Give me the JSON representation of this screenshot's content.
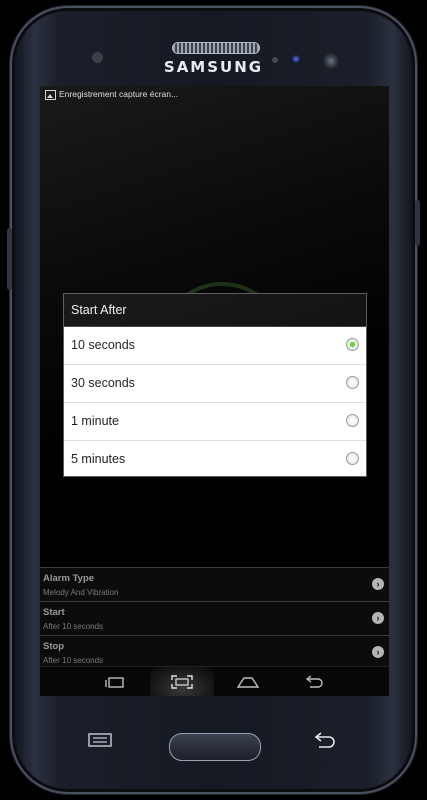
{
  "device": {
    "brand": "SAMSUNG"
  },
  "status_bar": {
    "notification_text": "Enregistrement capture écran...",
    "icon": "image-icon"
  },
  "dialog": {
    "title": "Start After",
    "options": [
      {
        "label": "10 seconds",
        "selected": true
      },
      {
        "label": "30 seconds",
        "selected": false
      },
      {
        "label": "1 minute",
        "selected": false
      },
      {
        "label": "5 minutes",
        "selected": false
      }
    ]
  },
  "settings": [
    {
      "title": "Alarm Type",
      "subtitle": "Melody And Vibration"
    },
    {
      "title": "Start",
      "subtitle": "After 10 seconds"
    },
    {
      "title": "Stop",
      "subtitle": "After 10 seconds"
    }
  ],
  "navbar": {
    "buttons": [
      "recent-apps-icon",
      "screenshot-icon",
      "home-icon",
      "back-icon"
    ]
  },
  "colors": {
    "accent_selected": "#6ad331"
  }
}
